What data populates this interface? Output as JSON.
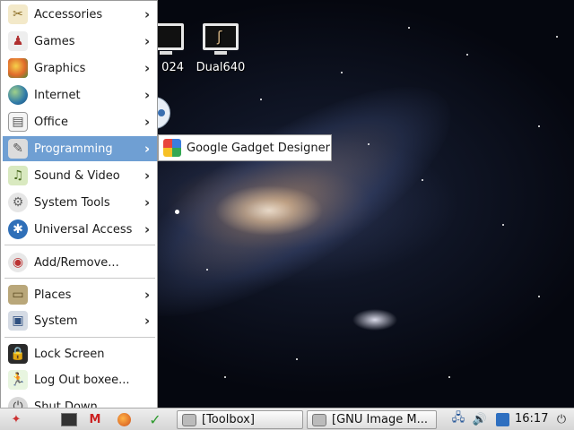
{
  "desktop": {
    "icons": [
      {
        "label": "024"
      },
      {
        "label": "Dual640"
      }
    ]
  },
  "menu": {
    "items": [
      {
        "label": "Accessories",
        "icon": "accessories-icon"
      },
      {
        "label": "Games",
        "icon": "games-icon"
      },
      {
        "label": "Graphics",
        "icon": "graphics-icon"
      },
      {
        "label": "Internet",
        "icon": "internet-globe-icon"
      },
      {
        "label": "Office",
        "icon": "office-icon"
      },
      {
        "label": "Programming",
        "icon": "programming-icon"
      },
      {
        "label": "Sound & Video",
        "icon": "sound-video-icon"
      },
      {
        "label": "System Tools",
        "icon": "system-tools-icon"
      },
      {
        "label": "Universal Access",
        "icon": "universal-access-icon"
      },
      {
        "label": "Add/Remove...",
        "icon": "add-remove-icon"
      },
      {
        "label": "Places",
        "icon": "places-folder-icon"
      },
      {
        "label": "System",
        "icon": "system-icon"
      },
      {
        "label": "Lock Screen",
        "icon": "lock-screen-icon"
      },
      {
        "label": "Log Out boxee...",
        "icon": "log-out-icon"
      },
      {
        "label": "Shut Down...",
        "icon": "shut-down-icon"
      }
    ],
    "arrow": "›",
    "active_color": "#6f9fd3"
  },
  "submenu": {
    "items": [
      {
        "label": "Google Gadget Designer",
        "icon": "google-gadgets-icon"
      }
    ]
  },
  "taskbar": {
    "tasks": [
      {
        "label": "[Toolbox]"
      },
      {
        "label": "[GNU Image M..."
      }
    ],
    "clock": "16:17"
  }
}
